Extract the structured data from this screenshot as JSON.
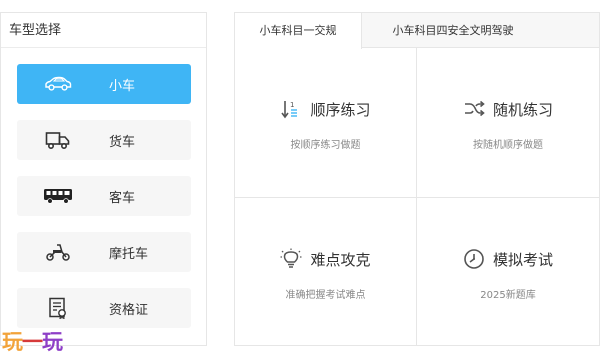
{
  "left_panel": {
    "header": "车型选择",
    "items": [
      {
        "label": "小车",
        "icon": "car-icon",
        "active": true
      },
      {
        "label": "货车",
        "icon": "truck-icon",
        "active": false
      },
      {
        "label": "客车",
        "icon": "bus-icon",
        "active": false
      },
      {
        "label": "摩托车",
        "icon": "motorcycle-icon",
        "active": false
      },
      {
        "label": "资格证",
        "icon": "certificate-icon",
        "active": false
      }
    ]
  },
  "right_panel": {
    "tabs": [
      {
        "label": "小车科目一交规",
        "active": true
      },
      {
        "label": "小车科目四安全文明驾驶",
        "active": false
      }
    ],
    "cells": [
      {
        "title": "顺序练习",
        "subtitle": "按顺序练习做题",
        "icon": "sort-order-icon"
      },
      {
        "title": "随机练习",
        "subtitle": "按随机顺序做题",
        "icon": "shuffle-icon"
      },
      {
        "title": "难点攻克",
        "subtitle": "准确把握考试难点",
        "icon": "lightbulb-icon"
      },
      {
        "title": "模拟考试",
        "subtitle": "2025新题库",
        "icon": "clock-icon"
      }
    ]
  },
  "watermark": {
    "c1": "玩",
    "c2": "一",
    "c3": "玩"
  },
  "colors": {
    "accent": "#3fb5f5",
    "border": "#e6e6e6",
    "item_bg": "#f6f6f6"
  }
}
